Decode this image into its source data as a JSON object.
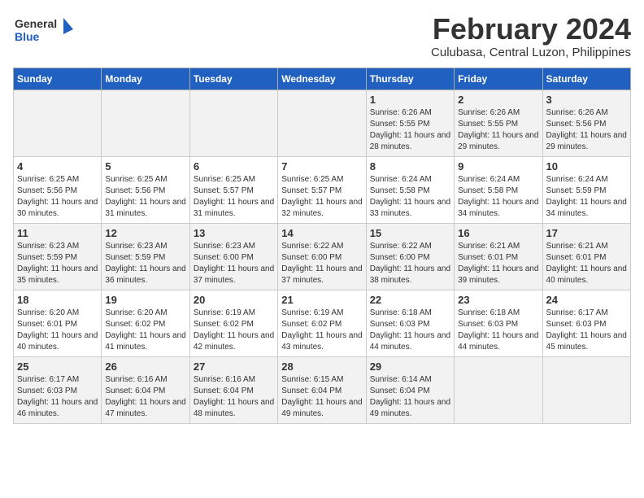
{
  "logo": {
    "line1": "General",
    "line2": "Blue"
  },
  "title": "February 2024",
  "subtitle": "Culubasa, Central Luzon, Philippines",
  "weekdays": [
    "Sunday",
    "Monday",
    "Tuesday",
    "Wednesday",
    "Thursday",
    "Friday",
    "Saturday"
  ],
  "weeks": [
    [
      {
        "day": "",
        "info": ""
      },
      {
        "day": "",
        "info": ""
      },
      {
        "day": "",
        "info": ""
      },
      {
        "day": "",
        "info": ""
      },
      {
        "day": "1",
        "info": "Sunrise: 6:26 AM\nSunset: 5:55 PM\nDaylight: 11 hours\nand 28 minutes."
      },
      {
        "day": "2",
        "info": "Sunrise: 6:26 AM\nSunset: 5:55 PM\nDaylight: 11 hours\nand 29 minutes."
      },
      {
        "day": "3",
        "info": "Sunrise: 6:26 AM\nSunset: 5:56 PM\nDaylight: 11 hours\nand 29 minutes."
      }
    ],
    [
      {
        "day": "4",
        "info": "Sunrise: 6:25 AM\nSunset: 5:56 PM\nDaylight: 11 hours\nand 30 minutes."
      },
      {
        "day": "5",
        "info": "Sunrise: 6:25 AM\nSunset: 5:56 PM\nDaylight: 11 hours\nand 31 minutes."
      },
      {
        "day": "6",
        "info": "Sunrise: 6:25 AM\nSunset: 5:57 PM\nDaylight: 11 hours\nand 31 minutes."
      },
      {
        "day": "7",
        "info": "Sunrise: 6:25 AM\nSunset: 5:57 PM\nDaylight: 11 hours\nand 32 minutes."
      },
      {
        "day": "8",
        "info": "Sunrise: 6:24 AM\nSunset: 5:58 PM\nDaylight: 11 hours\nand 33 minutes."
      },
      {
        "day": "9",
        "info": "Sunrise: 6:24 AM\nSunset: 5:58 PM\nDaylight: 11 hours\nand 34 minutes."
      },
      {
        "day": "10",
        "info": "Sunrise: 6:24 AM\nSunset: 5:59 PM\nDaylight: 11 hours\nand 34 minutes."
      }
    ],
    [
      {
        "day": "11",
        "info": "Sunrise: 6:23 AM\nSunset: 5:59 PM\nDaylight: 11 hours\nand 35 minutes."
      },
      {
        "day": "12",
        "info": "Sunrise: 6:23 AM\nSunset: 5:59 PM\nDaylight: 11 hours\nand 36 minutes."
      },
      {
        "day": "13",
        "info": "Sunrise: 6:23 AM\nSunset: 6:00 PM\nDaylight: 11 hours\nand 37 minutes."
      },
      {
        "day": "14",
        "info": "Sunrise: 6:22 AM\nSunset: 6:00 PM\nDaylight: 11 hours\nand 37 minutes."
      },
      {
        "day": "15",
        "info": "Sunrise: 6:22 AM\nSunset: 6:00 PM\nDaylight: 11 hours\nand 38 minutes."
      },
      {
        "day": "16",
        "info": "Sunrise: 6:21 AM\nSunset: 6:01 PM\nDaylight: 11 hours\nand 39 minutes."
      },
      {
        "day": "17",
        "info": "Sunrise: 6:21 AM\nSunset: 6:01 PM\nDaylight: 11 hours\nand 40 minutes."
      }
    ],
    [
      {
        "day": "18",
        "info": "Sunrise: 6:20 AM\nSunset: 6:01 PM\nDaylight: 11 hours\nand 40 minutes."
      },
      {
        "day": "19",
        "info": "Sunrise: 6:20 AM\nSunset: 6:02 PM\nDaylight: 11 hours\nand 41 minutes."
      },
      {
        "day": "20",
        "info": "Sunrise: 6:19 AM\nSunset: 6:02 PM\nDaylight: 11 hours\nand 42 minutes."
      },
      {
        "day": "21",
        "info": "Sunrise: 6:19 AM\nSunset: 6:02 PM\nDaylight: 11 hours\nand 43 minutes."
      },
      {
        "day": "22",
        "info": "Sunrise: 6:18 AM\nSunset: 6:03 PM\nDaylight: 11 hours\nand 44 minutes."
      },
      {
        "day": "23",
        "info": "Sunrise: 6:18 AM\nSunset: 6:03 PM\nDaylight: 11 hours\nand 44 minutes."
      },
      {
        "day": "24",
        "info": "Sunrise: 6:17 AM\nSunset: 6:03 PM\nDaylight: 11 hours\nand 45 minutes."
      }
    ],
    [
      {
        "day": "25",
        "info": "Sunrise: 6:17 AM\nSunset: 6:03 PM\nDaylight: 11 hours\nand 46 minutes."
      },
      {
        "day": "26",
        "info": "Sunrise: 6:16 AM\nSunset: 6:04 PM\nDaylight: 11 hours\nand 47 minutes."
      },
      {
        "day": "27",
        "info": "Sunrise: 6:16 AM\nSunset: 6:04 PM\nDaylight: 11 hours\nand 48 minutes."
      },
      {
        "day": "28",
        "info": "Sunrise: 6:15 AM\nSunset: 6:04 PM\nDaylight: 11 hours\nand 49 minutes."
      },
      {
        "day": "29",
        "info": "Sunrise: 6:14 AM\nSunset: 6:04 PM\nDaylight: 11 hours\nand 49 minutes."
      },
      {
        "day": "",
        "info": ""
      },
      {
        "day": "",
        "info": ""
      }
    ]
  ]
}
